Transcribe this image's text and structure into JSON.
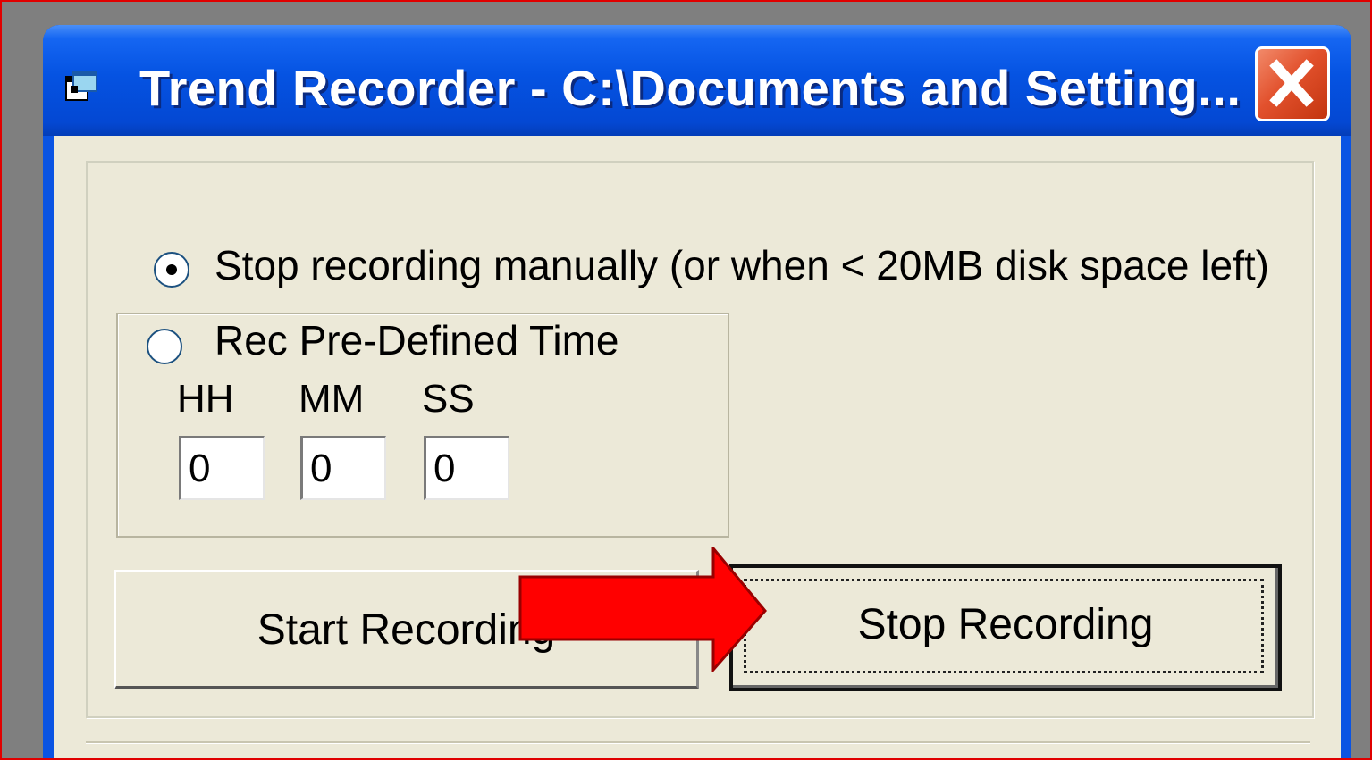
{
  "window": {
    "title": "Trend Recorder - C:\\Documents and Setting...",
    "icon": "app-window-icon",
    "close_icon": "close-icon",
    "titlebar_color": "#0553e2",
    "close_color": "#e2512d"
  },
  "options": {
    "manual_label": "Stop recording manually (or when < 20MB disk space left)",
    "manual_selected": true,
    "predefined_label": "Rec Pre-Defined Time",
    "predefined_selected": false
  },
  "time": {
    "hh_label": "HH",
    "mm_label": "MM",
    "ss_label": "SS",
    "hh_value": "0",
    "mm_value": "0",
    "ss_value": "0"
  },
  "buttons": {
    "start_label": "Start Recording",
    "stop_label": "Stop Recording"
  },
  "annotation": {
    "arrow_color": "#ff0000",
    "border_color": "#e00000"
  }
}
